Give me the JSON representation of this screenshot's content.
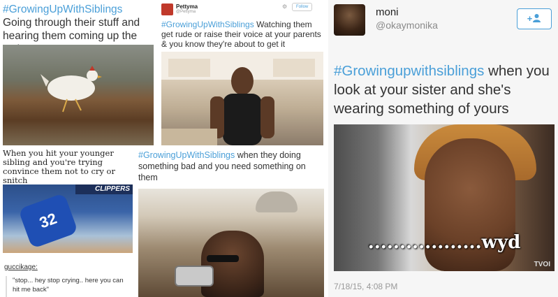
{
  "tile1": {
    "hashtag": "#GrowingUpWithSiblings",
    "text": " Going through their stuff and hearing them coming up the stairs"
  },
  "tile2": {
    "username": "Pettyma",
    "handle": "@Pettyma",
    "follow_label": "Follow",
    "hashtag": "#GrowingUpWithSiblings",
    "text": " Watching them get rude or raise their voice at your parents & you know they're about to get it"
  },
  "tile3": {
    "name": "moni",
    "handle": "@okaymonika",
    "follow_icon": "add-user-icon",
    "follow_label": "+👤",
    "hashtag": "#Growingupwithsiblings",
    "text": " when you look at your sister and she's wearing something of yours",
    "image_text": "..................wyd",
    "watermark": "TVOI",
    "timestamp": "7/18/15, 4:08 PM"
  },
  "tile4": {
    "caption": "When you hit your younger sibling and you're trying convince them not to cry or snitch",
    "banner": "CLIPPERS",
    "jersey": "32",
    "tumblr_user": "guccikage:",
    "quote": "\"stop... hey stop crying.. here you can hit me back\""
  },
  "tile5": {
    "hashtag": "#GrowingUpWithSiblings",
    "text": " when they doing something bad and you need something on them"
  },
  "colors": {
    "hashtag": "#4a9fd8",
    "follow_border": "#4a9fd8",
    "muted_text": "#8a8a8a"
  }
}
